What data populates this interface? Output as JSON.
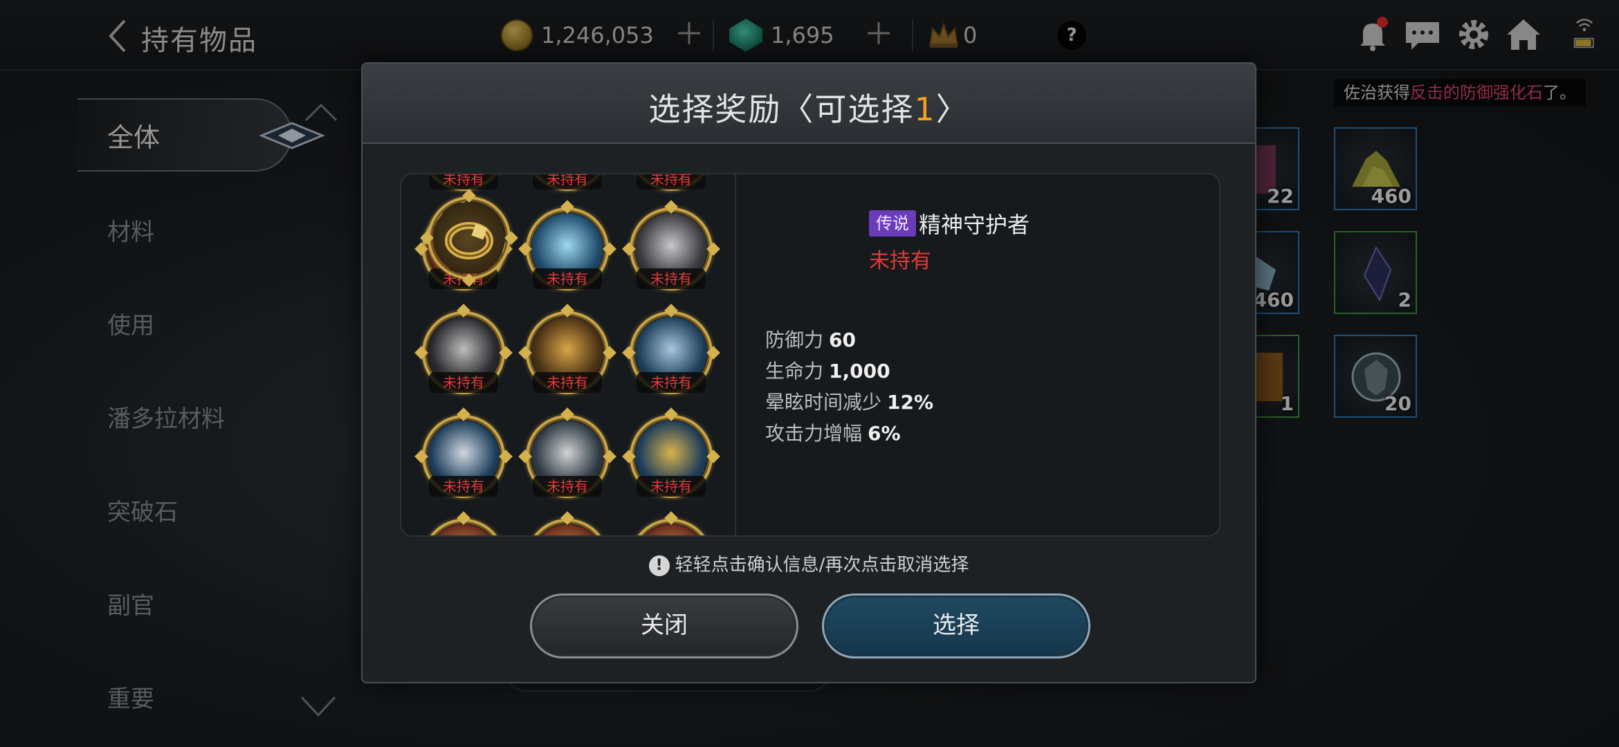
{
  "header": {
    "title": "持有物品",
    "gold": "1,246,053",
    "gems": "1,695",
    "crowns": "0",
    "help_label": "?"
  },
  "toast": {
    "prefix": "佐治获得",
    "highlight": "反击的防御强化石",
    "suffix": "了。"
  },
  "sidebar": {
    "active": "全体",
    "items": [
      "材料",
      "使用",
      "潘多拉材料",
      "突破石",
      "副官",
      "重要"
    ]
  },
  "inventory": {
    "quantities": [
      "22",
      "460",
      "460",
      "2",
      "1",
      "20"
    ]
  },
  "modal": {
    "title_prefix": "选择奖励〈可选择",
    "title_count": "1",
    "title_suffix": "〉",
    "reward_tag": "未持有",
    "detail": {
      "rarity": "传说",
      "name": "精神守护者",
      "status": "未持有",
      "stats": [
        {
          "label": "防御力",
          "value": "60"
        },
        {
          "label": "生命力",
          "value": "1,000"
        },
        {
          "label": "晕眩时间减少",
          "value": "12%"
        },
        {
          "label": "攻击力增幅",
          "value": "6%"
        }
      ]
    },
    "hint": "轻轻点击确认信息/再次点击取消选择",
    "close_label": "关闭",
    "select_label": "选择"
  },
  "colors": {
    "accent_gold": "#c9a548",
    "not_owned_red": "#e23a3a",
    "legendary_purple": "#6a3cb8",
    "count_orange": "#f2a020"
  }
}
